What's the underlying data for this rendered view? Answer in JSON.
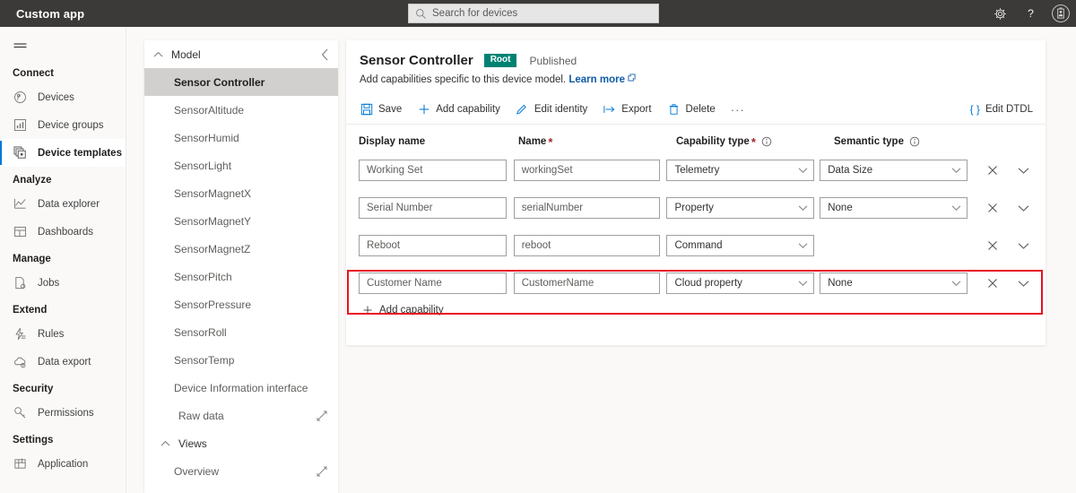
{
  "topbar": {
    "app_title": "Custom app",
    "search_placeholder": "Search for devices",
    "search_icon": "search-icon",
    "settings_icon": "gear-icon",
    "help_icon": "question-mark-icon",
    "account_icon": "account-avatar-icon"
  },
  "leftnav": {
    "menu_icon": "hamburger-icon",
    "sections": [
      {
        "title": "Connect",
        "items": [
          {
            "label": "Devices",
            "icon": "devices-icon",
            "selected": false
          },
          {
            "label": "Device groups",
            "icon": "device-groups-icon",
            "selected": false
          },
          {
            "label": "Device templates",
            "icon": "device-templates-icon",
            "selected": true
          }
        ]
      },
      {
        "title": "Analyze",
        "items": [
          {
            "label": "Data explorer",
            "icon": "line-chart-icon",
            "selected": false
          },
          {
            "label": "Dashboards",
            "icon": "dashboard-grid-icon",
            "selected": false
          }
        ]
      },
      {
        "title": "Manage",
        "items": [
          {
            "label": "Jobs",
            "icon": "jobs-document-icon",
            "selected": false
          }
        ]
      },
      {
        "title": "Extend",
        "items": [
          {
            "label": "Rules",
            "icon": "rules-icon",
            "selected": false
          },
          {
            "label": "Data export",
            "icon": "cloud-export-icon",
            "selected": false
          }
        ]
      },
      {
        "title": "Security",
        "items": [
          {
            "label": "Permissions",
            "icon": "key-icon",
            "selected": false
          }
        ]
      },
      {
        "title": "Settings",
        "items": [
          {
            "label": "Application",
            "icon": "application-grid-icon",
            "selected": false
          }
        ]
      }
    ]
  },
  "midpanel": {
    "header_label": "Model",
    "header_chevron_icon": "chevron-up-icon",
    "collapse_icon": "chevron-left-icon",
    "model_items": [
      {
        "label": "Sensor Controller",
        "active": true
      },
      {
        "label": "SensorAltitude",
        "active": false
      },
      {
        "label": "SensorHumid",
        "active": false
      },
      {
        "label": "SensorLight",
        "active": false
      },
      {
        "label": "SensorMagnetX",
        "active": false
      },
      {
        "label": "SensorMagnetY",
        "active": false
      },
      {
        "label": "SensorMagnetZ",
        "active": false
      },
      {
        "label": "SensorPitch",
        "active": false
      },
      {
        "label": "SensorPressure",
        "active": false
      },
      {
        "label": "SensorRoll",
        "active": false
      },
      {
        "label": "SensorTemp",
        "active": false
      },
      {
        "label": "Device Information interface",
        "active": false
      }
    ],
    "raw_data_label": "Raw data",
    "raw_data_icon": "open-expand-icon",
    "views_label": "Views",
    "views_chevron_icon": "chevron-up-icon",
    "overview_label": "Overview",
    "overview_icon": "open-expand-icon"
  },
  "main": {
    "title": "Sensor Controller",
    "badge": "Root",
    "status": "Published",
    "subtitle": "Add capabilities specific to this device model.",
    "learn_more": "Learn more",
    "learn_more_icon": "external-link-icon",
    "commands": [
      {
        "label": "Save",
        "icon": "save-floppy-icon"
      },
      {
        "label": "Add capability",
        "icon": "plus-icon"
      },
      {
        "label": "Edit identity",
        "icon": "pencil-icon"
      },
      {
        "label": "Export",
        "icon": "export-arrow-icon"
      },
      {
        "label": "Delete",
        "icon": "trash-icon"
      }
    ],
    "overflow_label": "···",
    "edit_dtdl": {
      "label": "Edit DTDL",
      "braces": "{ }",
      "icon": "curly-braces-icon"
    },
    "table": {
      "headers": [
        {
          "label": "Display name",
          "required": false,
          "info": false
        },
        {
          "label": "Name",
          "required": true,
          "info": false
        },
        {
          "label": "Capability type",
          "required": true,
          "info": true
        },
        {
          "label": "Semantic type",
          "required": false,
          "info": true
        }
      ],
      "rows": [
        {
          "display_name": "Working Set",
          "name": "workingSet",
          "capability_type": "Telemetry",
          "semantic_type": "Data Size",
          "has_semantic": true,
          "highlighted": false
        },
        {
          "display_name": "Serial Number",
          "name": "serialNumber",
          "capability_type": "Property",
          "semantic_type": "None",
          "has_semantic": true,
          "highlighted": false
        },
        {
          "display_name": "Reboot",
          "name": "reboot",
          "capability_type": "Command",
          "semantic_type": "",
          "has_semantic": false,
          "highlighted": false
        },
        {
          "display_name": "Customer Name",
          "name": "CustomerName",
          "capability_type": "Cloud property",
          "semantic_type": "None",
          "has_semantic": true,
          "highlighted": true
        }
      ],
      "row_delete_icon": "close-x-icon",
      "row_expand_icon": "chevron-down-icon"
    },
    "add_capability": {
      "label": "Add capability",
      "icon": "plus-icon"
    }
  },
  "colors": {
    "topbar_bg": "#3b3a39",
    "accent": "#0078d4",
    "badge_teal": "#008272",
    "highlight_red": "#e81123",
    "required_red": "#a4262c"
  }
}
